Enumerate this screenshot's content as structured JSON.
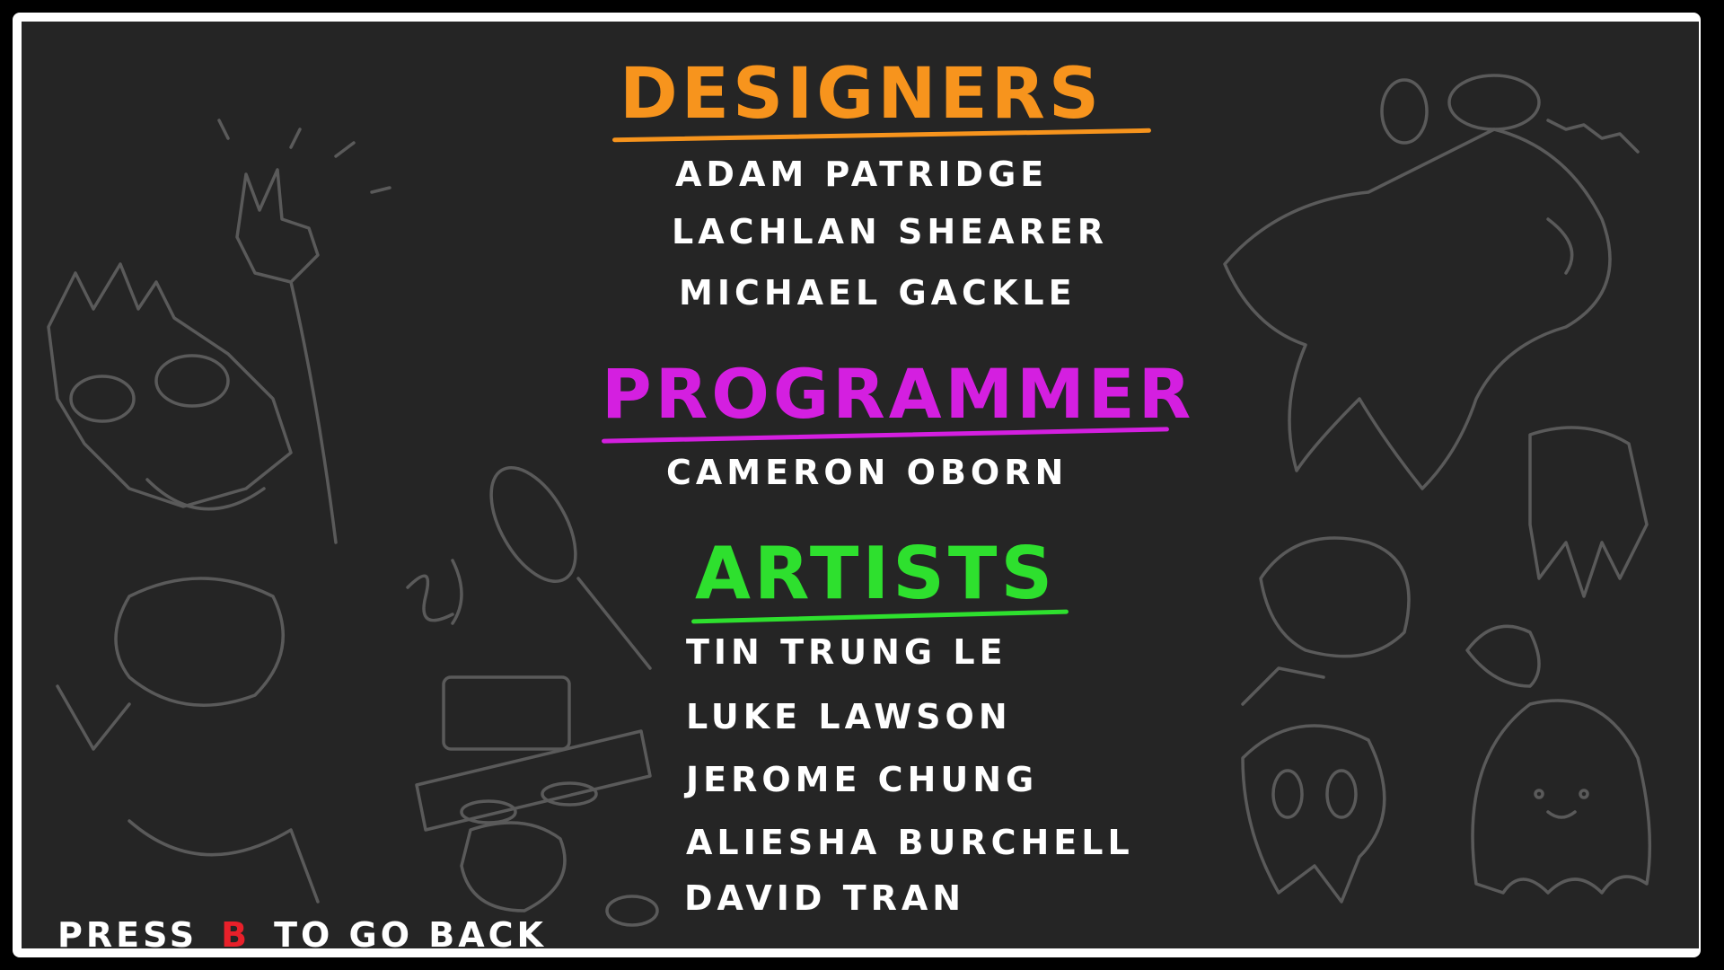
{
  "credits": {
    "designers": {
      "heading": "DESIGNERS",
      "color": "#f7941d",
      "names": [
        "ADAM PATRIDGE",
        "LACHLAN SHEARER",
        "MICHAEL GACKLE"
      ]
    },
    "programmer": {
      "heading": "PROGRAMMER",
      "color": "#d41fe0",
      "names": [
        "CAMERON OBORN"
      ]
    },
    "artists": {
      "heading": "ARTISTS",
      "color": "#2ee02e",
      "names": [
        "TIN TRUNG LE",
        "LUKE LAWSON",
        "JEROME CHUNG",
        "ALIESHA BURCHELL",
        "DAVID TRAN"
      ]
    }
  },
  "prompt": {
    "press": "PRESS",
    "key": "B",
    "rest": "TO GO BACK",
    "key_color": "#e8202a"
  },
  "background": {
    "board_color": "#252525",
    "doodle_color": "#5a5a5a",
    "frame_color": "#ffffff"
  }
}
